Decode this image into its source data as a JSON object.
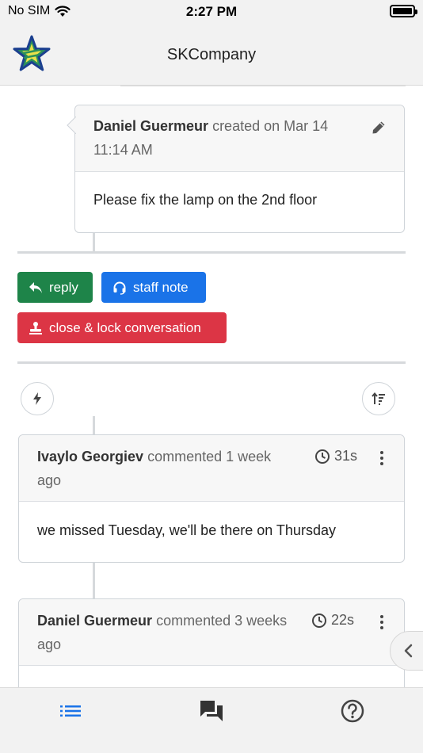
{
  "status_bar": {
    "carrier": "No SIM",
    "time": "2:27 PM"
  },
  "header": {
    "title": "SKCompany",
    "logo_icon": "star-logo-icon"
  },
  "original_post": {
    "author": "Daniel Guermeur",
    "action": "created on Mar 14 11:14 AM",
    "body": "Please fix the lamp on the 2nd floor",
    "edit_icon": "pencil-icon"
  },
  "actions": {
    "reply_label": "reply",
    "staff_note_label": "staff note",
    "close_label": "close & lock conversation"
  },
  "comments": [
    {
      "author": "Ivaylo Georgiev",
      "action": "commented 1 week ago",
      "elapsed": "31s",
      "body": "we missed Tuesday, we'll be there on Thursday"
    },
    {
      "author": "Daniel Guermeur",
      "action": "commented 3 weeks ago",
      "elapsed": "22s",
      "body": ""
    }
  ],
  "colors": {
    "reply": "#1e8449",
    "staff_note": "#1a73e8",
    "close": "#dc3545",
    "nav_active": "#1a73e8"
  },
  "bottom_nav": [
    {
      "name": "list",
      "icon": "list-icon"
    },
    {
      "name": "conversations",
      "icon": "chat-icon"
    },
    {
      "name": "help",
      "icon": "help-circle-icon"
    }
  ]
}
